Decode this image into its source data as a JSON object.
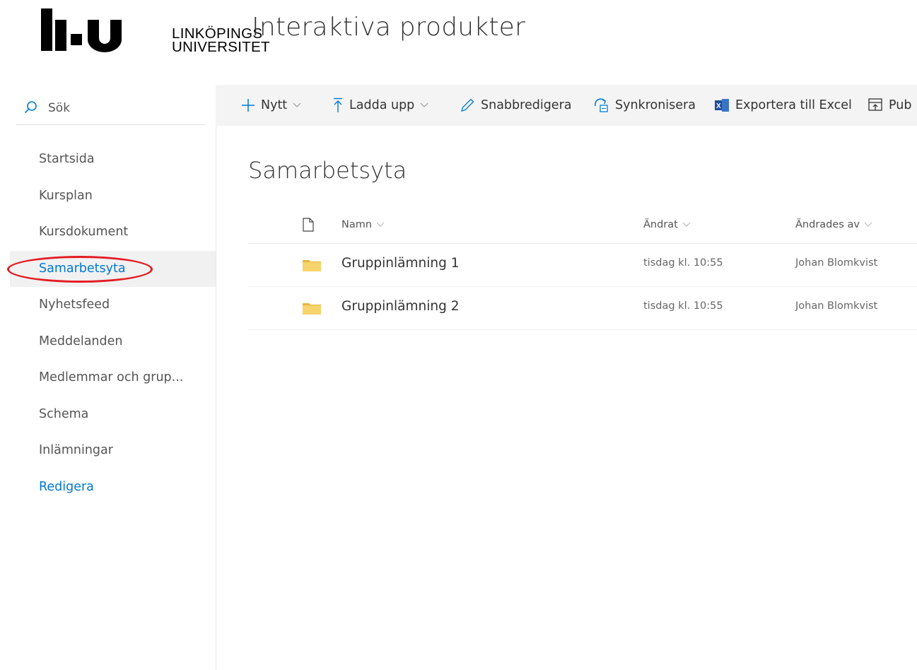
{
  "header": {
    "logo_text_line1": "LINKÖPINGS",
    "logo_text_line2": "UNIVERSITET",
    "site_title": "Interaktiva produkter"
  },
  "search": {
    "label": "Sök"
  },
  "nav": {
    "items": [
      {
        "label": "Startsida"
      },
      {
        "label": "Kursplan"
      },
      {
        "label": "Kursdokument"
      },
      {
        "label": "Samarbetsyta",
        "selected": true
      },
      {
        "label": "Nyhetsfeed"
      },
      {
        "label": "Meddelanden"
      },
      {
        "label": "Medlemmar och grup..."
      },
      {
        "label": "Schema"
      },
      {
        "label": "Inlämningar"
      }
    ],
    "edit_label": "Redigera"
  },
  "commandbar": {
    "new_label": "Nytt",
    "upload_label": "Ladda upp",
    "quickedit_label": "Snabbredigera",
    "sync_label": "Synkronisera",
    "export_label": "Exportera till Excel",
    "publish_label": "Pub"
  },
  "page": {
    "title": "Samarbetsyta"
  },
  "library": {
    "columns": {
      "name": "Namn",
      "modified": "Ändrat",
      "modified_by": "Ändrades av"
    },
    "rows": [
      {
        "name": "Gruppinlämning 1",
        "modified": "tisdag kl. 10:55",
        "modified_by": "Johan Blomkvist"
      },
      {
        "name": "Gruppinlämning 2",
        "modified": "tisdag kl. 10:55",
        "modified_by": "Johan Blomkvist"
      }
    ]
  },
  "colors": {
    "accent": "#0078d4",
    "annotation": "#e31b23",
    "folder": "#f6d36b",
    "excel": "#1e4e9c"
  }
}
